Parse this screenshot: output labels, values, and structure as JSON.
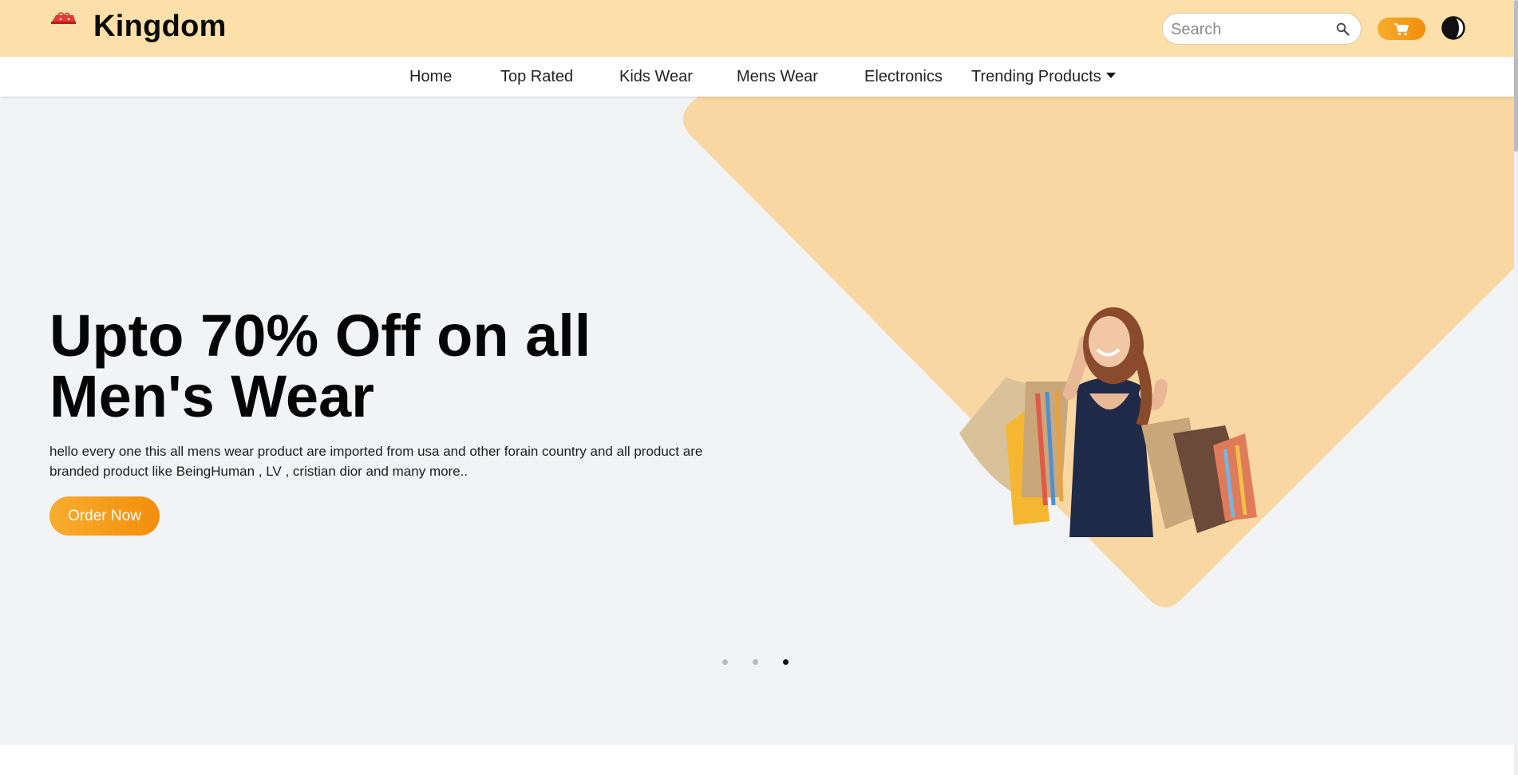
{
  "brand": {
    "name": "Kingdom",
    "logo_icon": "shopping-bag-logo"
  },
  "search": {
    "placeholder": "Search",
    "icon": "search-icon"
  },
  "header_actions": {
    "cart_icon": "cart-icon",
    "theme_icon": "dark-mode-toggle-icon"
  },
  "nav": {
    "items": [
      {
        "label": "Home"
      },
      {
        "label": "Top Rated"
      },
      {
        "label": "Kids Wear"
      },
      {
        "label": "Mens Wear"
      },
      {
        "label": "Electronics"
      },
      {
        "label": "Trending Products",
        "has_dropdown": true
      }
    ]
  },
  "hero": {
    "headline": "Upto 70% Off on all Men's Wear",
    "description": "hello every one this all mens wear product are imported from usa and other forain country and all product are branded product like BeingHuman , LV , cristian dior and many more..",
    "cta_label": "Order Now",
    "image": "woman-with-shopping-bags",
    "slides": {
      "count": 3,
      "active": 3
    }
  },
  "colors": {
    "header_bg": "#fddfa9",
    "accent": "#f4a21c",
    "hero_bg": "#f2f3f5",
    "diamond": "#f8d7a3"
  }
}
